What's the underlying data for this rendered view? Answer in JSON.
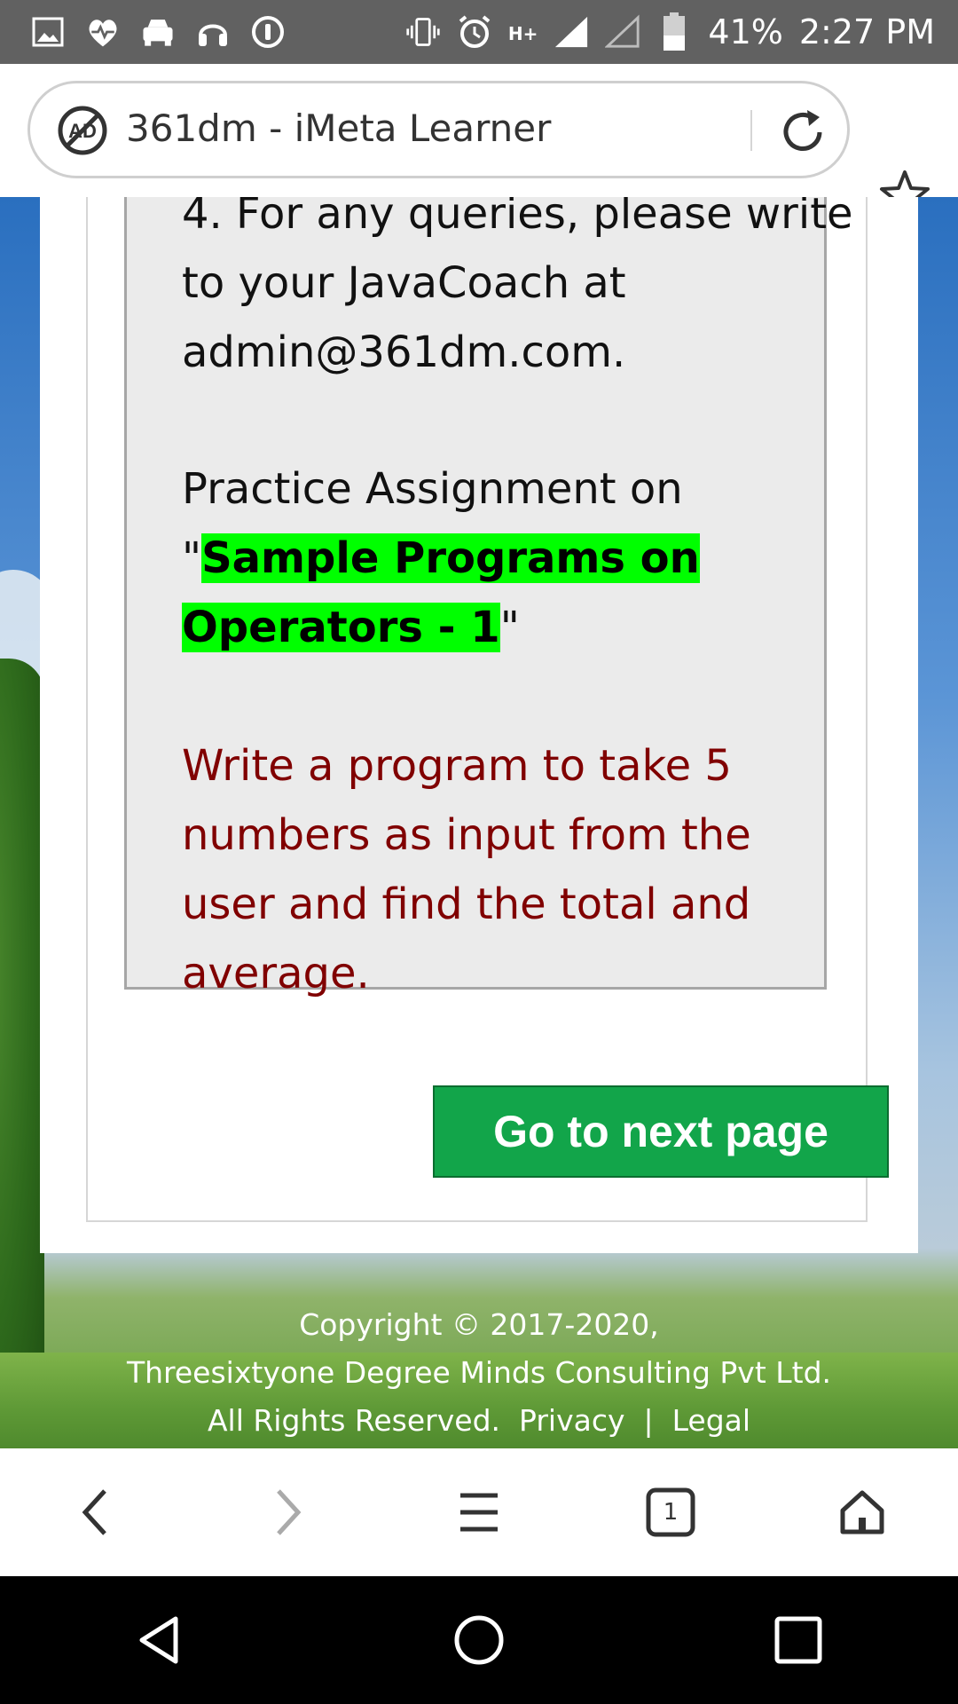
{
  "status_bar": {
    "battery_percent": "41%",
    "time": "2:27 PM",
    "network_label": "H+",
    "left_icons": [
      "gallery-icon",
      "health-icon",
      "car-icon",
      "headset-icon",
      "info-circle-icon"
    ],
    "right_icons": [
      "vibrate-icon",
      "alarm-icon",
      "signal-icon",
      "signal-empty-icon",
      "battery-icon"
    ]
  },
  "browser": {
    "page_title": "361dm - iMeta Learner",
    "tab_count": "1"
  },
  "content": {
    "query_note": "4. For any queries, please write to your JavaCoach at admin@361dm.com.",
    "practice_prefix": "Practice Assignment on",
    "practice_quote_open": "\"",
    "practice_title": "Sample Programs on Operators - 1",
    "practice_quote_close": "\"",
    "task": "Write a program to take 5 numbers as input from the user and find the total and average.",
    "next_button": "Go to next page"
  },
  "footer": {
    "line1": "Copyright © 2017-2020,",
    "line2": "Threesixtyone Degree Minds Consulting Pvt Ltd.",
    "rights": "All Rights Reserved.",
    "privacy": "Privacy",
    "separator": "|",
    "legal": "Legal"
  },
  "colors": {
    "highlight": "#00ff00",
    "task_text": "#800000",
    "button": "#12a54a"
  }
}
